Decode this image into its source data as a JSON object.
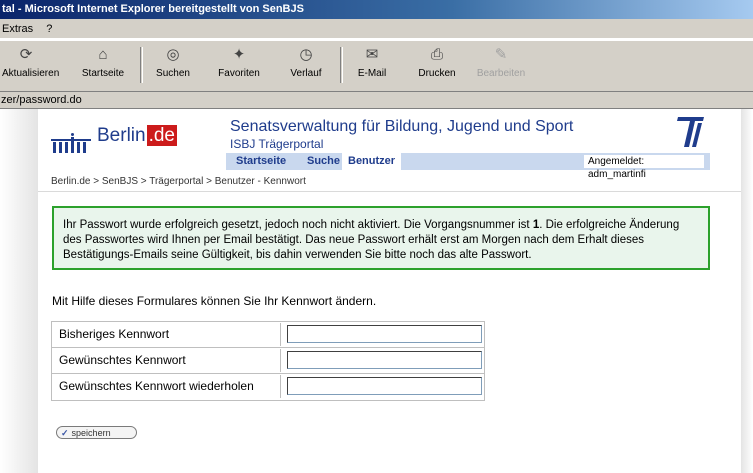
{
  "window": {
    "title": "tal - Microsoft Internet Explorer bereitgestellt von SenBJS"
  },
  "menu": [
    {
      "label": "Extras"
    },
    {
      "label": "?"
    }
  ],
  "toolbar": [
    {
      "label": "Aktualisieren",
      "icon": "refresh-icon",
      "glyph": "⟳"
    },
    {
      "label": "Startseite",
      "icon": "home-icon",
      "glyph": "⌂"
    },
    {
      "label": "Suchen",
      "icon": "search-icon",
      "glyph": "◎"
    },
    {
      "label": "Favoriten",
      "icon": "favorites-icon",
      "glyph": "✦"
    },
    {
      "label": "Verlauf",
      "icon": "history-icon",
      "glyph": "◷"
    },
    {
      "label": "E-Mail",
      "icon": "mail-icon",
      "glyph": "✉"
    },
    {
      "label": "Drucken",
      "icon": "print-icon",
      "glyph": "⎙"
    },
    {
      "label": "Bearbeiten",
      "icon": "edit-icon",
      "glyph": "✎"
    }
  ],
  "address": {
    "url": "zer/password.do"
  },
  "header": {
    "logo_text": "Berlin",
    "logo_suffix": ".de",
    "department": "Senatsverwaltung für Bildung, Jugend und Sport",
    "portal": "ISBJ Trägerportal",
    "nav": [
      {
        "label": "Startseite"
      },
      {
        "label": "Suche"
      },
      {
        "label": "Benutzer"
      }
    ],
    "logged_in": "Angemeldet: adm_martinfi",
    "brand_color": "#1f3c8c"
  },
  "breadcrumb": "Berlin.de > SenBJS > Trägerportal > Benutzer - Kennwort",
  "message": {
    "before": "Ihr Passwort wurde erfolgreich gesetzt, jedoch noch nicht aktiviert. Die Vorgangsnummer ist ",
    "number": "1",
    "after": ". Die erfolgreiche Änderung des Passwortes wird Ihnen per Email bestätigt. Das neue Passwort erhält erst am Morgen nach dem Erhalt dieses Bestätigungs-Emails seine Gültigkeit, bis dahin verwenden Sie bitte noch das alte Passwort.",
    "border_color": "#2ca12c"
  },
  "form": {
    "intro": "Mit Hilfe dieses Formulares können Sie Ihr Kennwort ändern.",
    "fields": [
      {
        "label": "Bisheriges Kennwort",
        "value": ""
      },
      {
        "label": "Gewünschtes Kennwort",
        "value": ""
      },
      {
        "label": "Gewünschtes Kennwort wiederholen",
        "value": ""
      }
    ],
    "save_label": "speichern"
  }
}
